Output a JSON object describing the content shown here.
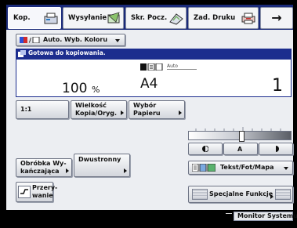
{
  "tabs": [
    {
      "label": "Kop.",
      "icon": "copy-icon",
      "active": true
    },
    {
      "label": "Wysyłanie",
      "icon": "send-icon"
    },
    {
      "label": "Skr. Pocz.",
      "icon": "mailbox-icon"
    },
    {
      "label": "Zad. Druku",
      "icon": "printer-icon"
    }
  ],
  "tab_arrow": "→",
  "color_mode": {
    "label": "Auto. Wyb. Koloru"
  },
  "status": {
    "text": "Gotowa do kopiowania."
  },
  "copy_panel": {
    "ratio": "100",
    "ratio_unit": "%",
    "paper_mode": "Auto",
    "paper_size": "A4",
    "copies": "1"
  },
  "buttons": {
    "ratio_1_1": "1:1",
    "size_line1": "Wielkość",
    "size_line2": "Kopia/Oryg.",
    "paper_line1": "Wybór",
    "paper_line2": "Papieru",
    "finishing_line1": "Obróbka Wy-",
    "finishing_line2": "kańczająca",
    "duplex": "Dwustronny",
    "interrupt_line1": "Przery-",
    "interrupt_line2": "wanie",
    "special": "Specjalne Funkcje"
  },
  "density": {
    "auto_label": "A"
  },
  "original_type": {
    "label": "Tekst/Fot/Mapa"
  },
  "footer": {
    "monitor": "Monitor Systemu"
  },
  "colors": {
    "header_blue": "#1a2a7a",
    "status_blue": "#1c2d8e",
    "screen_bg": "#eceef2"
  }
}
